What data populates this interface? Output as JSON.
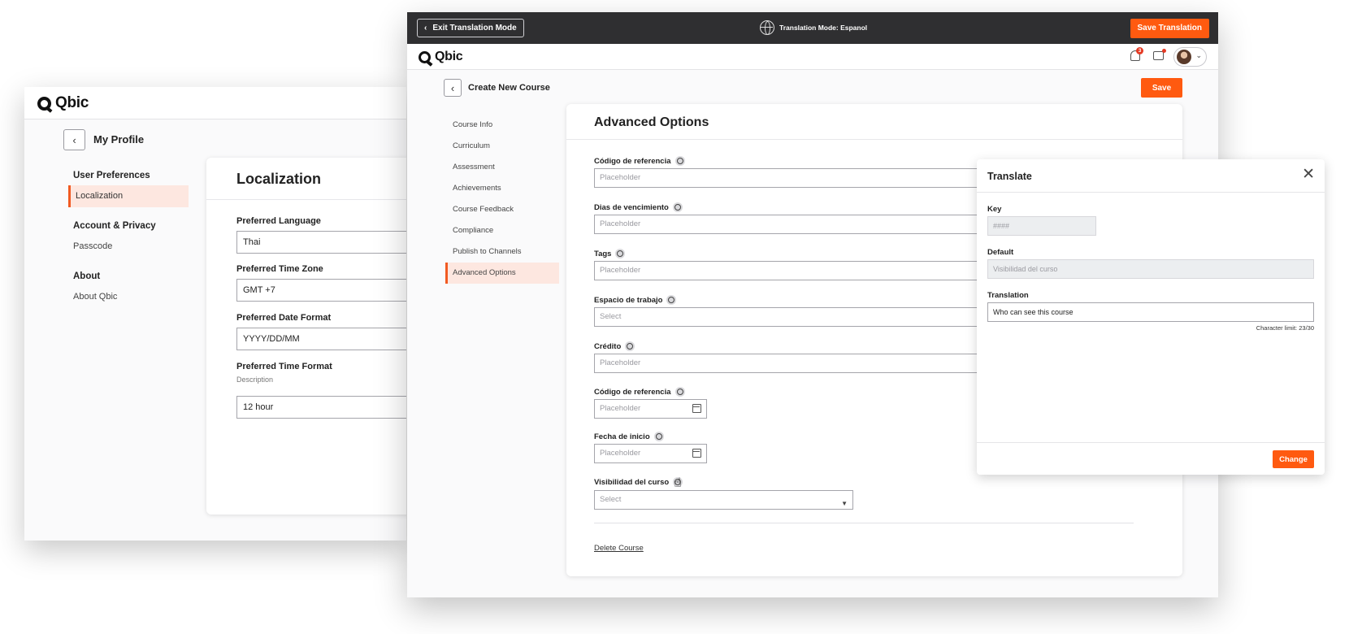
{
  "profile_window": {
    "logo": "Qbic",
    "title": "My Profile",
    "menu": {
      "user_preferences": "User Preferences",
      "localization": "Localization",
      "account_privacy": "Account & Privacy",
      "passcode": "Passcode",
      "about": "About",
      "about_qbic": "About Qbic"
    },
    "card_title": "Localization",
    "fields": {
      "language_label": "Preferred Language",
      "language_value": "Thai",
      "timezone_label": "Preferred Time Zone",
      "timezone_value": "GMT +7",
      "dateformat_label": "Preferred Date Format",
      "dateformat_value": "YYYY/DD/MM",
      "timeformat_label": "Preferred Time Format",
      "timeformat_desc": "Description",
      "timeformat_value": "12 hour"
    }
  },
  "course_window": {
    "translation_bar": {
      "exit_label": "Exit Translation Mode",
      "mode_text": "Translation Mode: Espanol",
      "save_label": "Save Translation"
    },
    "logo": "Qbic",
    "notification_count": "3",
    "page_title": "Create New Course",
    "save_label": "Save",
    "nav": [
      "Course Info",
      "Curriculum",
      "Assessment",
      "Achievements",
      "Course Feedback",
      "Compliance",
      "Publish to Channels",
      "Advanced Options"
    ],
    "card_title": "Advanced Options",
    "fields": {
      "ref_label": "Código de referencia",
      "ref_placeholder": "Placeholder",
      "expiry_label": "Dias de vencimiento",
      "expiry_placeholder": "Placeholder",
      "tags_label": "Tags",
      "tags_placeholder": "Placeholder",
      "workspace_label": "Espacio de trabajo",
      "workspace_placeholder": "Select",
      "credit_label": "Crédito",
      "credit_placeholder": "Placeholder",
      "ref2_label": "Código de referencia",
      "ref2_placeholder": "Placeholder",
      "start_label": "Fecha de inicio",
      "start_placeholder": "Placeholder",
      "visibility_label": "Visibilidad del curso",
      "visibility_placeholder": "Select"
    },
    "delete_label": "Delete Course"
  },
  "translate_panel": {
    "title": "Translate",
    "key_label": "Key",
    "key_value": "####",
    "default_label": "Default",
    "default_value": "Visibilidad del curso",
    "translation_label": "Translation",
    "translation_value": "Who can see this course",
    "char_limit": "Character limit: 23/30",
    "change_label": "Change"
  },
  "colors": {
    "accent": "#ff5a10",
    "active_bg": "#fde7e0",
    "dark_bar": "#2f2f31"
  }
}
